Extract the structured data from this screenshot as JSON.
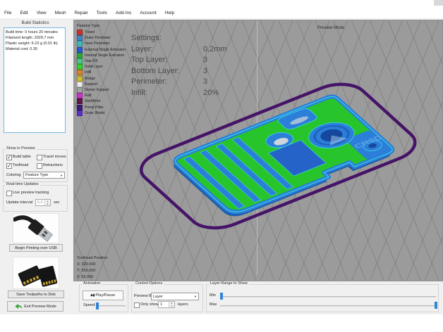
{
  "window": {
    "preview_mode_label": "Preview Mode"
  },
  "menu": {
    "items": [
      "File",
      "Edit",
      "View",
      "Mesh",
      "Repair",
      "Tools",
      "Add-Ins",
      "Account",
      "Help"
    ]
  },
  "left_panel": {
    "build_statistics": {
      "title": "Build Statistics",
      "lines": [
        "Build time: 0 hours 20 minutes",
        "Filament length: 2029.7 mm",
        "Plastic weight: 6.10 g (0.01 lb)",
        "Material cost: 0.30"
      ]
    },
    "show_in_preview": {
      "title": "Show in Preview",
      "build_table": {
        "label": "Build table",
        "checked": true
      },
      "travel_moves": {
        "label": "Travel moves",
        "checked": false
      },
      "toolhead": {
        "label": "Toolhead",
        "checked": true
      },
      "retractions": {
        "label": "Retractions",
        "checked": false
      },
      "coloring_label": "Coloring",
      "coloring_value": "Feature Type"
    },
    "realtime_updates": {
      "title": "Real-time Updates",
      "live_preview": {
        "label": "Live preview tracking",
        "checked": false
      },
      "update_interval_label": "Update interval",
      "update_interval_value": "5,0",
      "update_interval_unit": "sec"
    },
    "begin_printing_button": "Begin Printing over USB",
    "save_toolpaths_button": "Save Toolpaths to Disk",
    "exit_preview_button": "Exit Preview Mode"
  },
  "viewport": {
    "legend": {
      "title": "Feature Type",
      "items": [
        {
          "label": "Travel",
          "color": "#c8342c"
        },
        {
          "label": "Outer Perimeter",
          "color": "#3d85c8"
        },
        {
          "label": "Inner Perimeter",
          "color": "#3bbcbc"
        },
        {
          "label": "External Single Extrusion",
          "color": "#2c59d8"
        },
        {
          "label": "Internal Single Extrusion",
          "color": "#2fa83a"
        },
        {
          "label": "Gap Fill",
          "color": "#45c888"
        },
        {
          "label": "Solid Layer",
          "color": "#31d331"
        },
        {
          "label": "Infill",
          "color": "#e0822a"
        },
        {
          "label": "Bridge",
          "color": "#cfc02a"
        },
        {
          "label": "Support",
          "color": "#ececec"
        },
        {
          "label": "Dense Support",
          "color": "#a3a3a3"
        },
        {
          "label": "Raft",
          "color": "#cc33cc"
        },
        {
          "label": "Skirt/Brim",
          "color": "#5e1a47"
        },
        {
          "label": "Prime Pillar",
          "color": "#3f1b78"
        },
        {
          "label": "Ooze Shield",
          "color": "#5b31cf"
        }
      ]
    },
    "settings_overlay": {
      "title": "Settings:",
      "rows": [
        {
          "label": "Layer:",
          "value": "0,2mm"
        },
        {
          "label": "Top Layer:",
          "value": "3"
        },
        {
          "label": "Bottom Layer:",
          "value": "3"
        },
        {
          "label": "Perimeter:",
          "value": "3"
        },
        {
          "label": "Infill:",
          "value": "20%"
        }
      ]
    },
    "toolhead_position": {
      "title": "Toolhead Position",
      "x": "X: 320.000",
      "y": "Y: 250.000",
      "z": "Z: 55.000"
    },
    "model_text": "CR3D"
  },
  "bottom_bar": {
    "animation": {
      "title": "Animation",
      "play_icon": "▶▮",
      "play_pause_label": "Play/Pause",
      "speed_label": "Speed:"
    },
    "control_options": {
      "title": "Control Options",
      "preview_by_label": "Preview By",
      "preview_by_value": "Layer",
      "only_show": {
        "label": "Only show",
        "checked": false
      },
      "only_show_value": "1",
      "layers_label": "layers"
    },
    "layer_range": {
      "title": "Layer Range to Show",
      "min_label": "Min",
      "max_label": "Max"
    }
  }
}
